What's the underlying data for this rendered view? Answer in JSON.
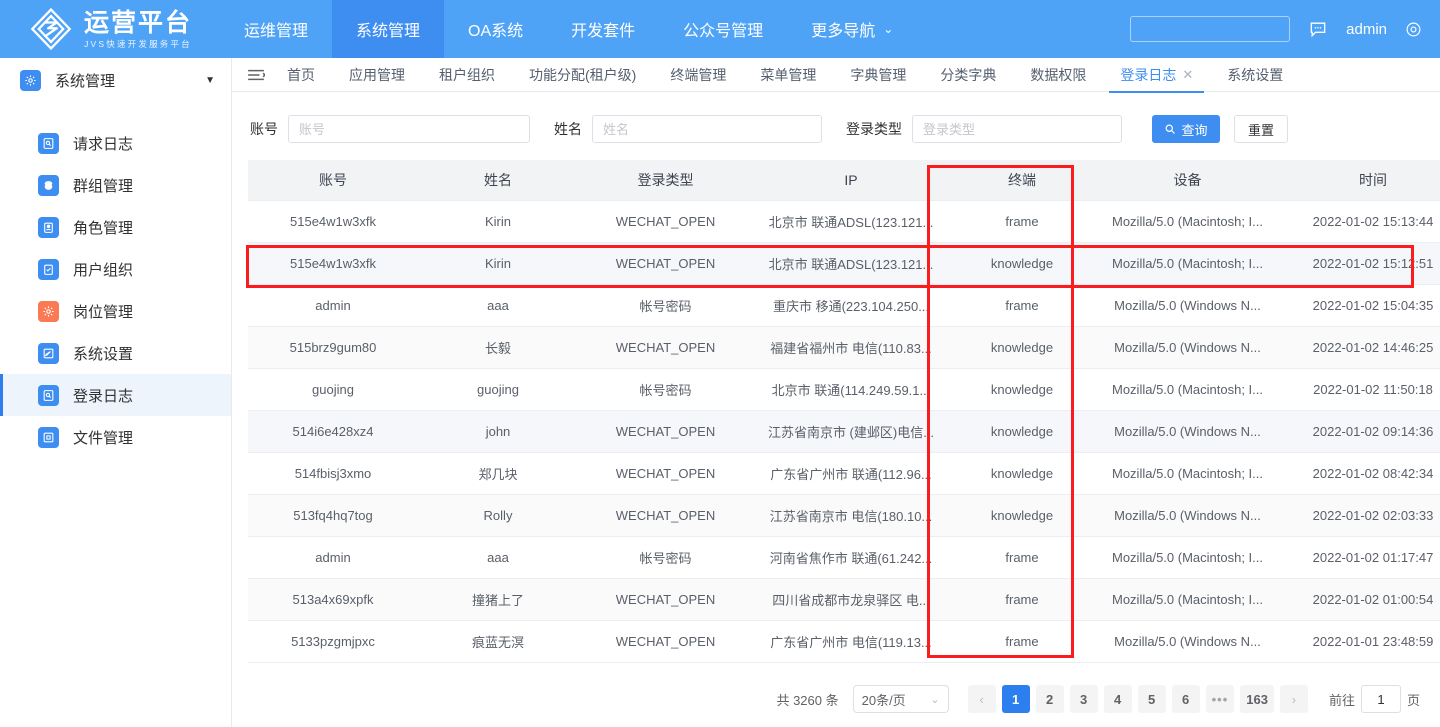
{
  "brand": {
    "title": "运营平台",
    "subtitle": "JVS快速开发服务平台",
    "logo_icon": "diamond-logo-icon"
  },
  "topnav": {
    "items": [
      {
        "label": "运维管理",
        "active": false
      },
      {
        "label": "系统管理",
        "active": true
      },
      {
        "label": "OA系统",
        "active": false
      },
      {
        "label": "开发套件",
        "active": false
      },
      {
        "label": "公众号管理",
        "active": false
      },
      {
        "label": "更多导航",
        "active": false,
        "caret": "⌄"
      }
    ],
    "search_value": "",
    "search_placeholder": "",
    "message_icon": "chat-bubble-icon",
    "user_label": "admin",
    "user_icon": "user-settings-icon"
  },
  "sidebar": {
    "header": {
      "label": "系统管理",
      "icon": "gear-icon",
      "caret": "▼"
    },
    "items": [
      {
        "label": "请求日志",
        "icon": "request-log-icon",
        "color": "blue",
        "active": false
      },
      {
        "label": "群组管理",
        "icon": "group-icon",
        "color": "blue",
        "active": false
      },
      {
        "label": "角色管理",
        "icon": "role-icon",
        "color": "blue",
        "active": false
      },
      {
        "label": "用户组织",
        "icon": "user-org-icon",
        "color": "blue",
        "active": false
      },
      {
        "label": "岗位管理",
        "icon": "position-gear-icon",
        "color": "orange",
        "active": false
      },
      {
        "label": "系统设置",
        "icon": "settings-edit-icon",
        "color": "blue",
        "active": false
      },
      {
        "label": "登录日志",
        "icon": "login-log-icon",
        "color": "blue",
        "active": true
      },
      {
        "label": "文件管理",
        "icon": "file-icon",
        "color": "blue",
        "active": false
      }
    ]
  },
  "tabs": {
    "menu_icon": "menu-collapse-icon",
    "items": [
      {
        "label": "首页",
        "active": false,
        "closable": false
      },
      {
        "label": "应用管理",
        "active": false,
        "closable": false
      },
      {
        "label": "租户组织",
        "active": false,
        "closable": false
      },
      {
        "label": "功能分配(租户级)",
        "active": false,
        "closable": false
      },
      {
        "label": "终端管理",
        "active": false,
        "closable": false
      },
      {
        "label": "菜单管理",
        "active": false,
        "closable": false
      },
      {
        "label": "字典管理",
        "active": false,
        "closable": false
      },
      {
        "label": "分类字典",
        "active": false,
        "closable": false
      },
      {
        "label": "数据权限",
        "active": false,
        "closable": false
      },
      {
        "label": "登录日志",
        "active": true,
        "closable": true,
        "close_glyph": "✕"
      },
      {
        "label": "系统设置",
        "active": false,
        "closable": false
      }
    ]
  },
  "filter": {
    "account_label": "账号",
    "account_value": "",
    "account_placeholder": "账号",
    "name_label": "姓名",
    "name_value": "",
    "name_placeholder": "姓名",
    "logintype_label": "登录类型",
    "logintype_value": "",
    "logintype_placeholder": "登录类型",
    "search_button": "查询",
    "search_icon": "search-icon",
    "reset_button": "重置"
  },
  "table": {
    "columns": [
      "账号",
      "姓名",
      "登录类型",
      "IP",
      "终端",
      "设备",
      "时间"
    ],
    "rows": [
      [
        "515e4w1w3xfk",
        "Kirin",
        "WECHAT_OPEN",
        "北京市 联通ADSL(123.121...",
        "frame",
        "Mozilla/5.0 (Macintosh; I...",
        "2022-01-02 15:13:44"
      ],
      [
        "515e4w1w3xfk",
        "Kirin",
        "WECHAT_OPEN",
        "北京市 联通ADSL(123.121...",
        "knowledge",
        "Mozilla/5.0 (Macintosh; I...",
        "2022-01-02 15:12:51"
      ],
      [
        "admin",
        "aaa",
        "帐号密码",
        "重庆市 移通(223.104.250...",
        "frame",
        "Mozilla/5.0 (Windows N...",
        "2022-01-02 15:04:35"
      ],
      [
        "515brz9gum80",
        "长毅",
        "WECHAT_OPEN",
        "福建省福州市 电信(110.83...",
        "knowledge",
        "Mozilla/5.0 (Windows N...",
        "2022-01-02 14:46:25"
      ],
      [
        "guojing",
        "guojing",
        "帐号密码",
        "北京市 联通(114.249.59.1...",
        "knowledge",
        "Mozilla/5.0 (Macintosh; I...",
        "2022-01-02 11:50:18"
      ],
      [
        "514i6e428xz4",
        "john",
        "WECHAT_OPEN",
        "江苏省南京市 (建邺区)电信...",
        "knowledge",
        "Mozilla/5.0 (Windows N...",
        "2022-01-02 09:14:36"
      ],
      [
        "514fbisj3xmo",
        "郑几块",
        "WECHAT_OPEN",
        "广东省广州市 联通(112.96...",
        "knowledge",
        "Mozilla/5.0 (Macintosh; I...",
        "2022-01-02 08:42:34"
      ],
      [
        "513fq4hq7tog",
        "Rolly",
        "WECHAT_OPEN",
        "江苏省南京市 电信(180.10...",
        "knowledge",
        "Mozilla/5.0 (Windows N...",
        "2022-01-02 02:03:33"
      ],
      [
        "admin",
        "aaa",
        "帐号密码",
        "河南省焦作市 联通(61.242...",
        "frame",
        "Mozilla/5.0 (Macintosh; I...",
        "2022-01-02 01:17:47"
      ],
      [
        "513a4x69xpfk",
        "撞猪上了",
        "WECHAT_OPEN",
        "四川省成都市龙泉驿区 电...",
        "frame",
        "Mozilla/5.0 (Macintosh; I...",
        "2022-01-02 01:00:54"
      ],
      [
        "5133pzgmjpxc",
        "痕蓝无溟",
        "WECHAT_OPEN",
        "广东省广州市 电信(119.13...",
        "frame",
        "Mozilla/5.0 (Windows N...",
        "2022-01-01 23:48:59"
      ]
    ]
  },
  "pagination": {
    "total_text": "共 3260 条",
    "page_size": "20条/页",
    "page_size_caret": "⌄",
    "prev_glyph": "‹",
    "next_glyph": "›",
    "pages": [
      "1",
      "2",
      "3",
      "4",
      "5",
      "6"
    ],
    "dots": "•••",
    "last_page": "163",
    "active_page": "1",
    "goto_label": "前往",
    "goto_value": "1",
    "goto_unit": "页"
  },
  "annotations": {
    "accent_color": "#fb1d1d",
    "row_highlight_index": 1,
    "column_highlight": "终端"
  }
}
